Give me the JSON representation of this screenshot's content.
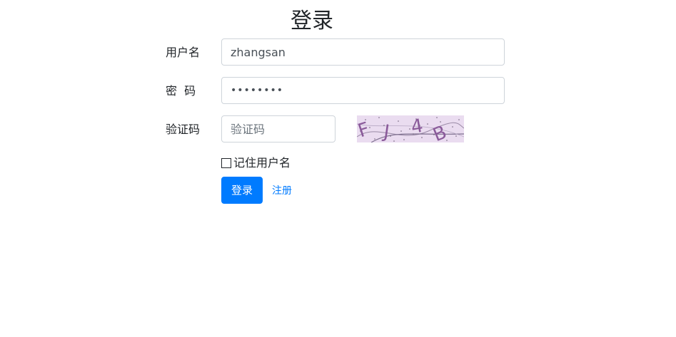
{
  "page": {
    "title": "登录"
  },
  "form": {
    "username": {
      "label": "用户名",
      "value": "zhangsan"
    },
    "password": {
      "label": "密  码",
      "value": "••••••••"
    },
    "captcha": {
      "label": "验证码",
      "placeholder": "验证码",
      "image_text": "FJ4B"
    },
    "remember": {
      "label": "记住用户名",
      "checked": false
    },
    "submit_label": "登录",
    "register_label": "注册"
  },
  "colors": {
    "primary": "#007bff",
    "captcha_bg": "#eadcf0",
    "captcha_text": "#8a5a9a"
  },
  "icons": {
    "checkbox": "checkbox-unchecked-icon"
  }
}
